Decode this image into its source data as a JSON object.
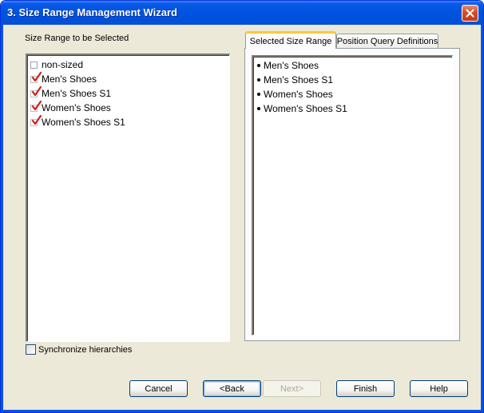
{
  "window": {
    "title": "3. Size Range Management Wizard"
  },
  "left_panel": {
    "label": "Size Range to be Selected",
    "items": [
      {
        "label": "non-sized",
        "checked": false
      },
      {
        "label": "Men's Shoes",
        "checked": true
      },
      {
        "label": "Men's Shoes S1",
        "checked": true
      },
      {
        "label": "Women's Shoes",
        "checked": true
      },
      {
        "label": "Women's Shoes S1",
        "checked": true
      }
    ]
  },
  "tabs": [
    {
      "label": "Selected Size Range",
      "active": true
    },
    {
      "label": "Position Query Definitions",
      "active": false
    }
  ],
  "selected_list": {
    "items": [
      "Men's Shoes",
      "Men's Shoes S1",
      "Women's Shoes",
      "Women's Shoes S1"
    ]
  },
  "sync_checkbox": {
    "label": "Synchronize hierarchies",
    "checked": false
  },
  "buttons": {
    "cancel": "Cancel",
    "back": "<Back",
    "next": "Next>",
    "finish": "Finish",
    "help": "Help"
  },
  "colors": {
    "titlebar": "#0053e0",
    "dialog_bg": "#ece9d8",
    "active_tab_accent": "#ffc83c",
    "checkmark": "#d0201a"
  }
}
